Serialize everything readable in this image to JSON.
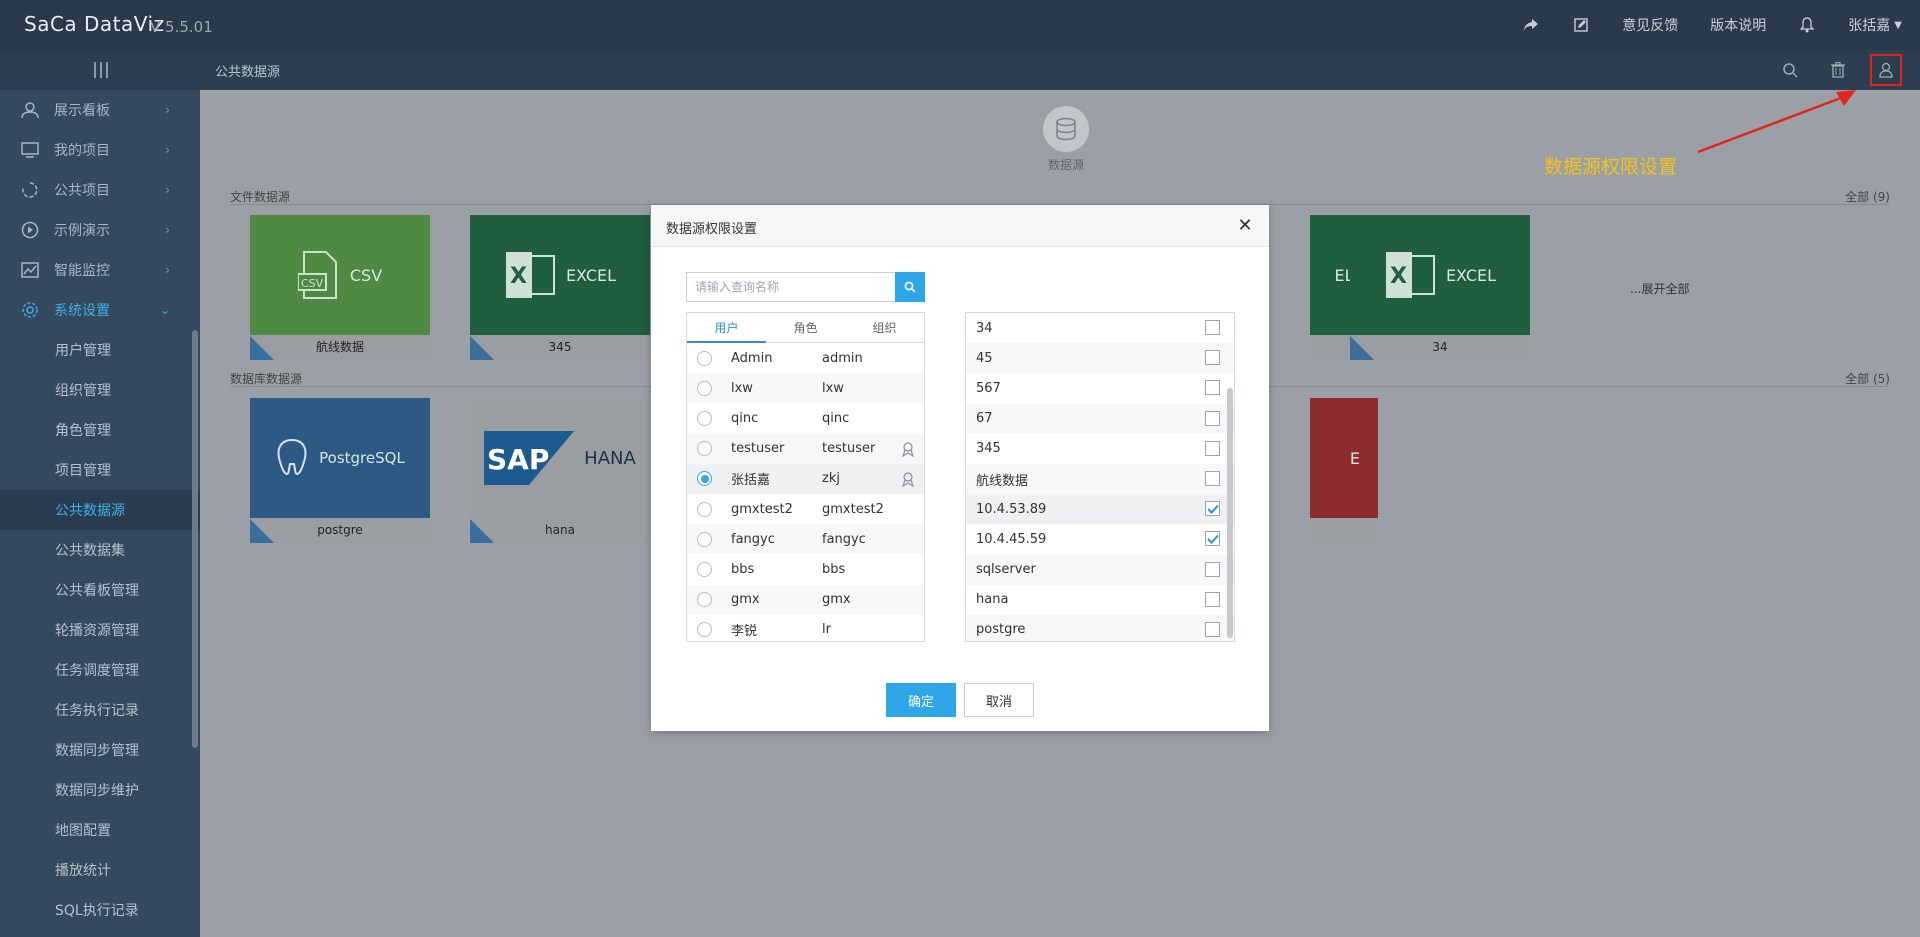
{
  "header": {
    "brand": "SaCa DataViz",
    "version": "V 5.5.01",
    "share_icon": "share-icon",
    "edit_icon": "edit-icon",
    "feedback_label": "意见反馈",
    "release_notes_label": "版本说明",
    "bell_icon": "bell-icon",
    "user_name": "张括嘉"
  },
  "subbar": {
    "breadcrumb": "公共数据源",
    "icons": [
      "search-icon",
      "trash-icon",
      "user-permission-icon"
    ]
  },
  "sidebar": {
    "items": [
      {
        "label": "展示看板",
        "icon": "user-icon"
      },
      {
        "label": "我的项目",
        "icon": "monitor-icon"
      },
      {
        "label": "公共项目",
        "icon": "refresh-icon"
      },
      {
        "label": "示例演示",
        "icon": "play-icon"
      },
      {
        "label": "智能监控",
        "icon": "chart-icon"
      },
      {
        "label": "系统设置",
        "icon": "gear-icon"
      }
    ],
    "sub_items": [
      "用户管理",
      "组织管理",
      "角色管理",
      "项目管理",
      "公共数据源",
      "公共数据集",
      "公共看板管理",
      "轮播资源管理",
      "任务调度管理",
      "任务执行记录",
      "数据同步管理",
      "数据同步维护",
      "地图配置",
      "播放统计",
      "SQL执行记录"
    ],
    "active_sub": "公共数据源"
  },
  "main": {
    "ds_button_label": "数据源",
    "file_section": {
      "title": "文件数据源",
      "count": "全部 (9)"
    },
    "db_section": {
      "title": "数据库数据源",
      "count": "全部 (5)"
    },
    "file_cards": [
      {
        "thumb_text": "CSV",
        "caption": "航线数据",
        "color": "#4f8a45"
      },
      {
        "thumb_text": "EXCEL",
        "caption": "345",
        "color": "#1f5e3e"
      },
      {
        "thumb_text": "EL",
        "caption": "",
        "color": "#1f5e3e"
      },
      {
        "thumb_text": "EXCEL",
        "caption": "34",
        "color": "#1f5e3e"
      }
    ],
    "db_cards": [
      {
        "thumb_text": "PostgreSQL",
        "caption": "postgre",
        "color": "#2d5a85"
      },
      {
        "thumb_text": "HANA",
        "caption": "hana",
        "color": "#9a9ea2"
      },
      {
        "thumb_text": "E",
        "caption": "",
        "color": "#8e2d30"
      }
    ],
    "expand_all": "...展开全部"
  },
  "annotation": {
    "label": "数据源权限设置",
    "color": "#f4c21c"
  },
  "modal": {
    "title": "数据源权限设置",
    "close_icon": "close-icon",
    "search_placeholder": "请输入查询名称",
    "tabs": [
      "用户",
      "角色",
      "组织"
    ],
    "active_tab": "用户",
    "users": [
      {
        "name": "Admin",
        "id": "admin",
        "badge": false,
        "selected": false
      },
      {
        "name": "lxw",
        "id": "lxw",
        "badge": false,
        "selected": false
      },
      {
        "name": "qinc",
        "id": "qinc",
        "badge": false,
        "selected": false
      },
      {
        "name": "testuser",
        "id": "testuser",
        "badge": true,
        "selected": false
      },
      {
        "name": "张括嘉",
        "id": "zkj",
        "badge": true,
        "selected": true
      },
      {
        "name": "gmxtest2",
        "id": "gmxtest2",
        "badge": false,
        "selected": false
      },
      {
        "name": "fangyc",
        "id": "fangyc",
        "badge": false,
        "selected": false
      },
      {
        "name": "bbs",
        "id": "bbs",
        "badge": false,
        "selected": false
      },
      {
        "name": "gmx",
        "id": "gmx",
        "badge": false,
        "selected": false
      },
      {
        "name": "李锐",
        "id": "lr",
        "badge": false,
        "selected": false
      }
    ],
    "datasources": [
      {
        "name": "34",
        "checked": false
      },
      {
        "name": "45",
        "checked": false
      },
      {
        "name": "567",
        "checked": false
      },
      {
        "name": "67",
        "checked": false
      },
      {
        "name": "345",
        "checked": false
      },
      {
        "name": "航线数据",
        "checked": false
      },
      {
        "name": "10.4.53.89",
        "checked": true
      },
      {
        "name": "10.4.45.59",
        "checked": true
      },
      {
        "name": "sqlserver",
        "checked": false
      },
      {
        "name": "hana",
        "checked": false
      },
      {
        "name": "postgre",
        "checked": false
      }
    ],
    "ok_label": "确定",
    "cancel_label": "取消"
  }
}
